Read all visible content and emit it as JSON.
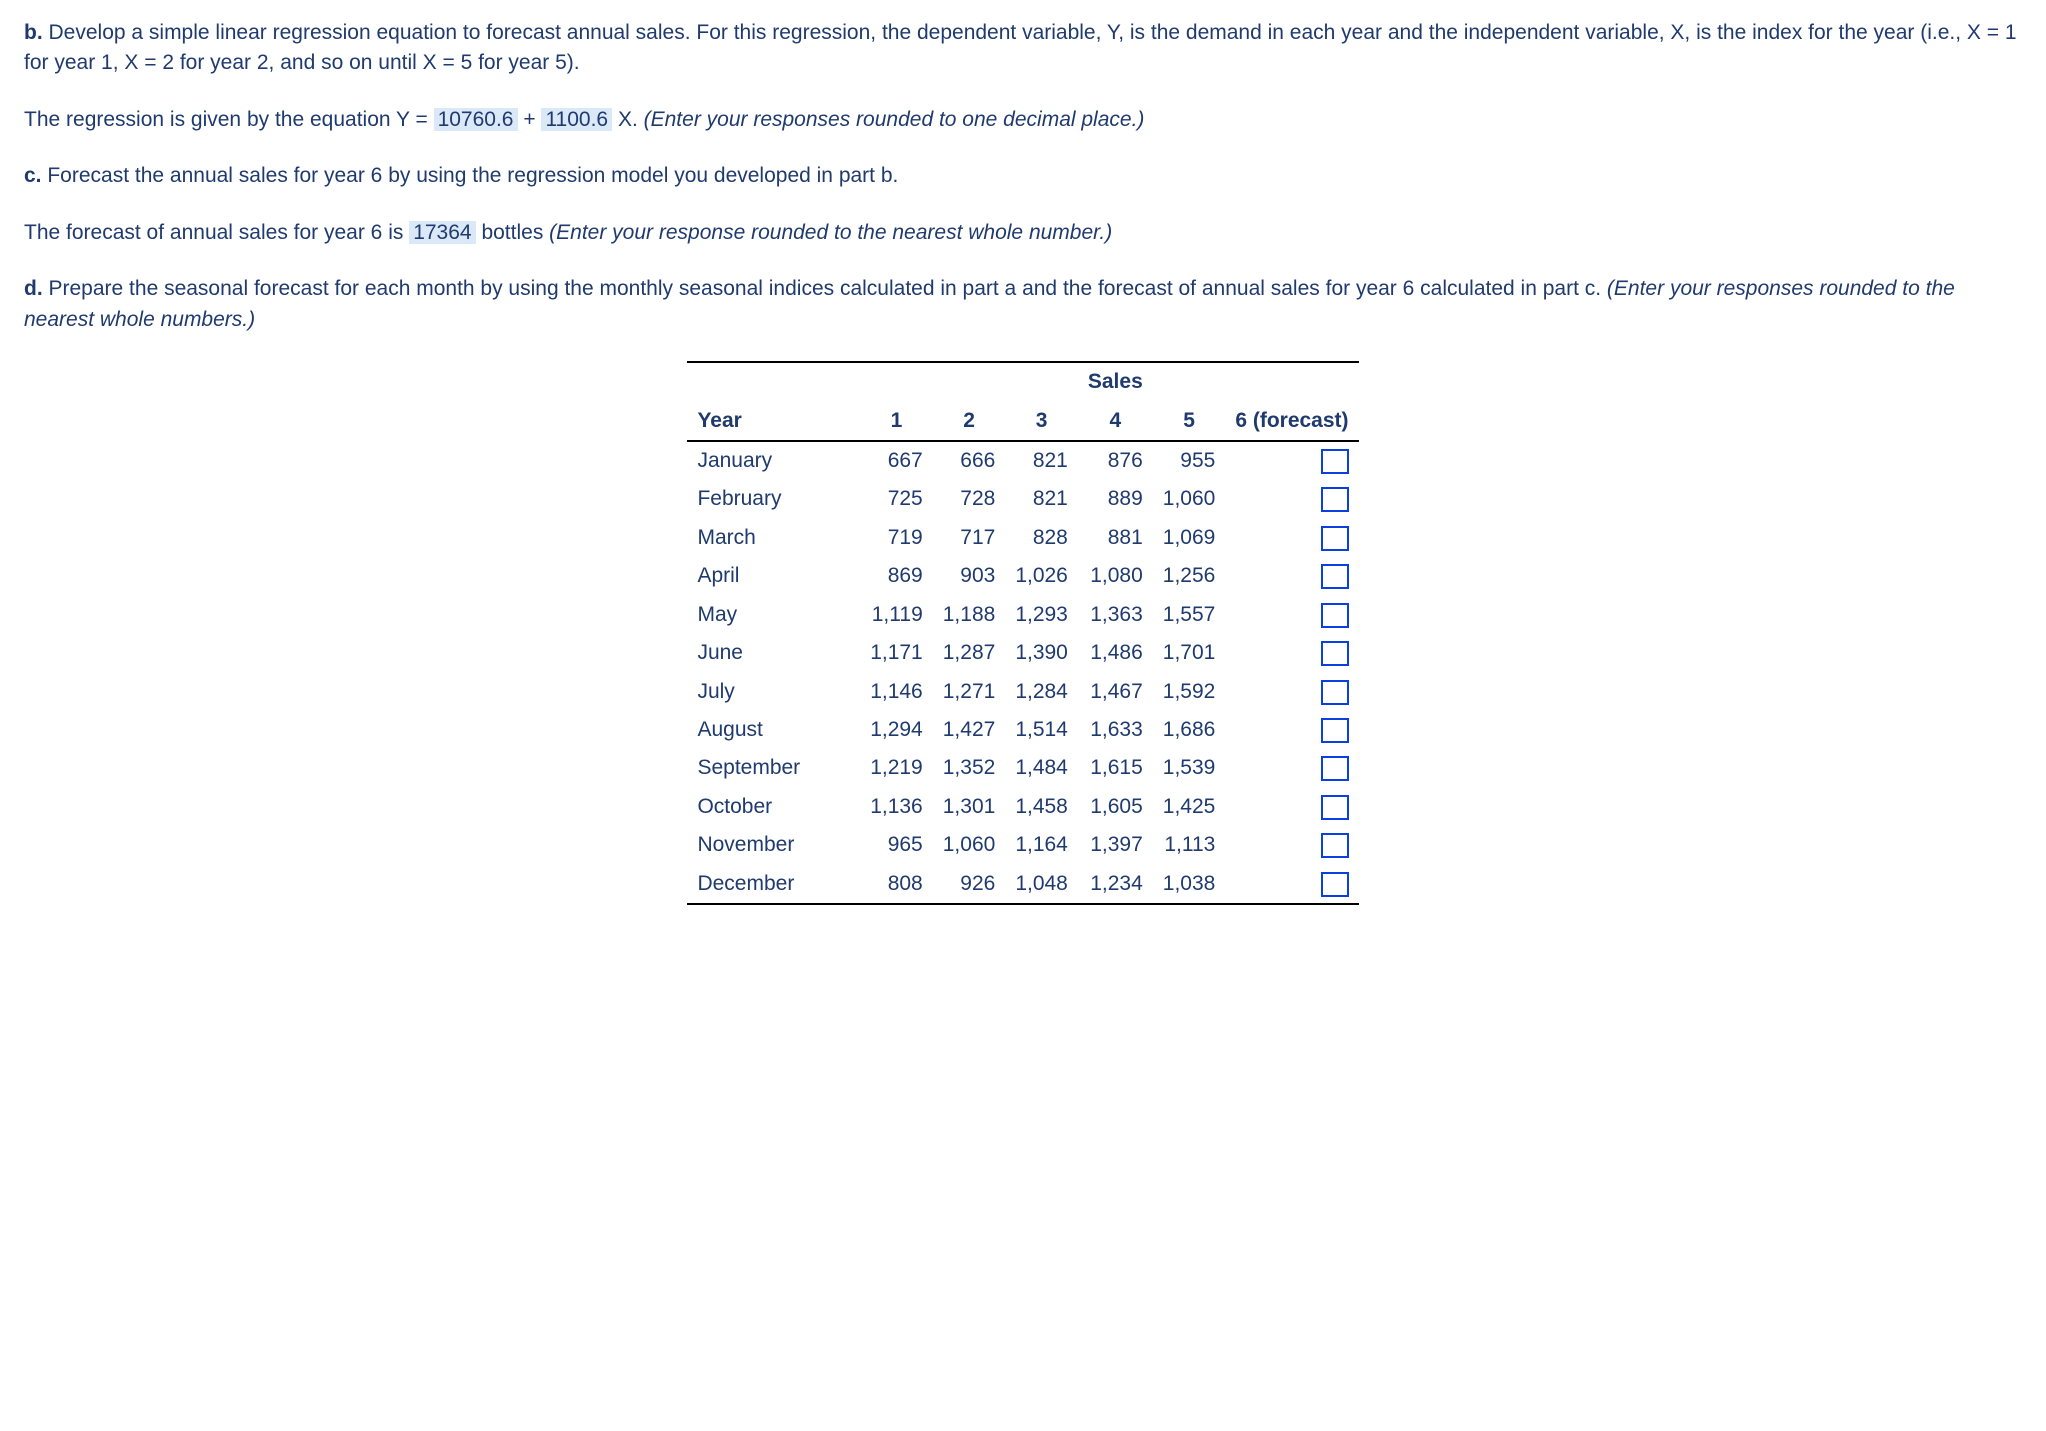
{
  "part_b": {
    "label": "b.",
    "text1": " Develop a simple linear regression equation to forecast annual sales. For this regression, the dependent variable, Y, is the demand in each year and the independent variable, X, is the index for the year (i.e., X = 1 for year 1, X = 2 for year 2, and so on until X = 5 for year 5).",
    "eq_pre": "The regression is given by the equation Y = ",
    "eq_a": "10760.6",
    "eq_plus": " + ",
    "eq_b": "1100.6",
    "eq_post": " X. ",
    "eq_hint": "(Enter your responses rounded to one decimal place.)"
  },
  "part_c": {
    "label": "c.",
    "text1": " Forecast the annual sales for year 6 by using the regression model you developed in part b.",
    "line_pre": "The forecast of annual sales for year 6 is ",
    "value": "17364",
    "line_post": " bottles ",
    "hint": "(Enter your response rounded to the nearest whole number.)"
  },
  "part_d": {
    "label": "d.",
    "text1": " Prepare the seasonal forecast for each month by using the monthly seasonal indices calculated in part a and the forecast of annual sales for year 6 calculated in part c. ",
    "hint": "(Enter your responses rounded to the nearest whole numbers.)"
  },
  "table": {
    "sales_header": "Sales",
    "year_label": "Year",
    "col_labels": [
      "1",
      "2",
      "3",
      "4",
      "5",
      "6 (forecast)"
    ],
    "rows": [
      {
        "month": "January",
        "v": [
          "667",
          "666",
          "821",
          "876",
          "955"
        ]
      },
      {
        "month": "February",
        "v": [
          "725",
          "728",
          "821",
          "889",
          "1,060"
        ]
      },
      {
        "month": "March",
        "v": [
          "719",
          "717",
          "828",
          "881",
          "1,069"
        ]
      },
      {
        "month": "April",
        "v": [
          "869",
          "903",
          "1,026",
          "1,080",
          "1,256"
        ]
      },
      {
        "month": "May",
        "v": [
          "1,119",
          "1,188",
          "1,293",
          "1,363",
          "1,557"
        ]
      },
      {
        "month": "June",
        "v": [
          "1,171",
          "1,287",
          "1,390",
          "1,486",
          "1,701"
        ]
      },
      {
        "month": "July",
        "v": [
          "1,146",
          "1,271",
          "1,284",
          "1,467",
          "1,592"
        ]
      },
      {
        "month": "August",
        "v": [
          "1,294",
          "1,427",
          "1,514",
          "1,633",
          "1,686"
        ]
      },
      {
        "month": "September",
        "v": [
          "1,219",
          "1,352",
          "1,484",
          "1,615",
          "1,539"
        ]
      },
      {
        "month": "October",
        "v": [
          "1,136",
          "1,301",
          "1,458",
          "1,605",
          "1,425"
        ]
      },
      {
        "month": "November",
        "v": [
          "965",
          "1,060",
          "1,164",
          "1,397",
          "1,113"
        ]
      },
      {
        "month": "December",
        "v": [
          "808",
          "926",
          "1,048",
          "1,234",
          "1,038"
        ]
      }
    ]
  }
}
